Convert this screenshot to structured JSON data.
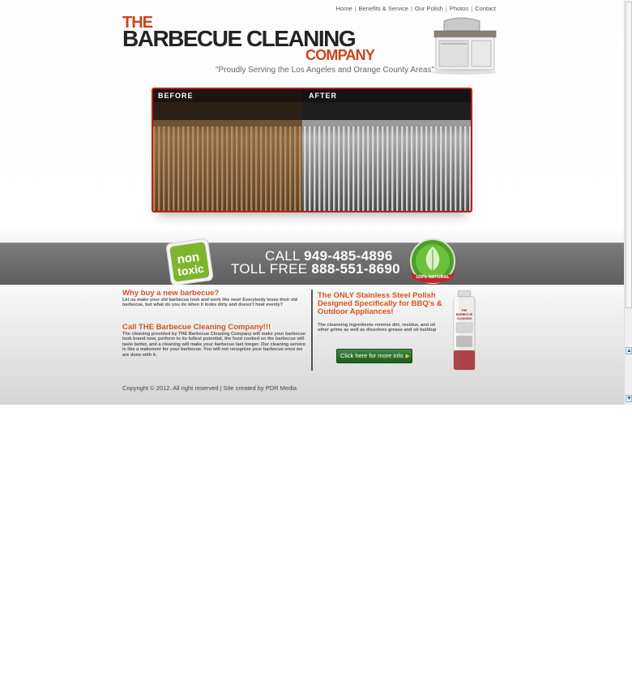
{
  "nav": {
    "items": [
      "Home",
      "Benefits & Service",
      "Our Polish",
      "Photos",
      "Contact"
    ],
    "separator": "|"
  },
  "logo": {
    "the": "THE",
    "main": "BARBECUE CLEANING",
    "company": "COMPANY"
  },
  "tagline": "\"Proudly Serving the Los Angeles and Orange County Areas\"",
  "banner": {
    "before_label": "BEFORE",
    "after_label": "AFTER"
  },
  "phones": {
    "call_label": "CALL",
    "call_number": "949-485-4896",
    "tollfree_label": "TOLL FREE",
    "tollfree_number": "888-551-8690"
  },
  "badges": {
    "nontoxic_line1": "non",
    "nontoxic_line2": "toxic",
    "natural": "100% NATURAL"
  },
  "left_col": {
    "why_title": "Why buy a new barbecue?",
    "why_text": "Let us make your old barbecue look and work like new! Everybody loves their old barbecue, but what do you do when it looks dirty and doesn't heat evenly?",
    "call_title": "Call THE Barbecue Cleaning Company!!!",
    "call_text": "The cleaning provided by THE Barbecue Cleaning Company will make your barbecue look brand new, perform to its fullest potential, the food cooked on the barbecue will taste better, and a cleaning will make your barbecue last longer. Our cleaning service is like a makeover for your barbecue. You will not recognize your barbecue once we are done with it."
  },
  "right_col": {
    "polish_title": "The ONLY Stainless Steel Polish Designed Specifically for BBQ's & Outdoor Appliances!",
    "polish_text": "The cleansing ingredients remove dirt, residue, and oil other grime as well as dissolves grease and oil buildup",
    "button_label": "Click here for more info",
    "can_label_1": "THE",
    "can_label_2": "BARBECUE",
    "can_label_3": "CLEANING"
  },
  "footer": {
    "copyright": "Copyright © 2012. All right reserved | Site created by PDR Media"
  },
  "colors": {
    "accent_orange": "#d2531e",
    "banner_border": "#c21d1d",
    "phonebar": "#6b6b6b",
    "button_green": "#2f6f2f"
  },
  "icons": [
    "grill-image",
    "nontoxic-badge",
    "natural-leaf-badge",
    "polish-can",
    "play-arrow-icon"
  ]
}
